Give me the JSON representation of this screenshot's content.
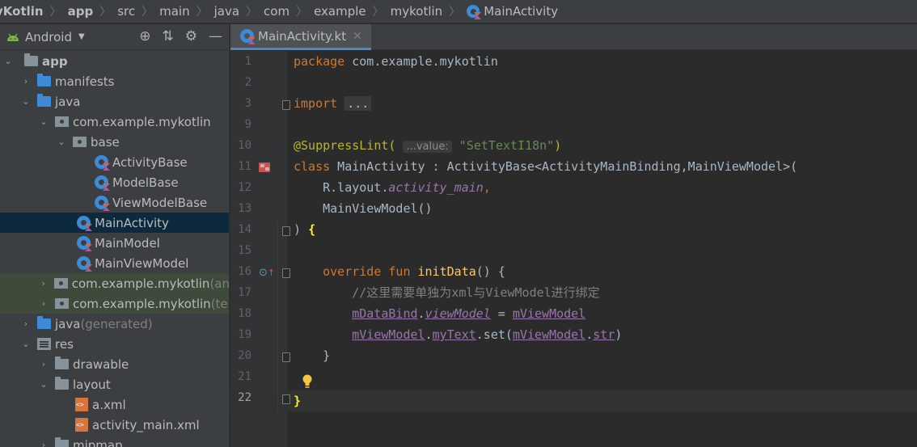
{
  "breadcrumb": [
    "yKotlin",
    "app",
    "src",
    "main",
    "java",
    "com",
    "example",
    "mykotlin",
    "MainActivity"
  ],
  "project": {
    "view_label": "Android",
    "toolbar_icons": [
      "locate-icon",
      "collapse-all-icon",
      "settings-gear-icon",
      "hide-icon"
    ],
    "tree": [
      {
        "label": "app",
        "suffix": "",
        "kind": "module",
        "expanded": true
      },
      {
        "label": "manifests",
        "suffix": "",
        "kind": "folder-blue",
        "expanded": false
      },
      {
        "label": "java",
        "suffix": "",
        "kind": "folder-blue",
        "expanded": true
      },
      {
        "label": "com.example.mykotlin",
        "suffix": "",
        "kind": "package",
        "expanded": true
      },
      {
        "label": "base",
        "suffix": "",
        "kind": "package",
        "expanded": true
      },
      {
        "label": "ActivityBase",
        "suffix": "",
        "kind": "kotlin"
      },
      {
        "label": "ModelBase",
        "suffix": "",
        "kind": "kotlin"
      },
      {
        "label": "ViewModelBase",
        "suffix": "",
        "kind": "kotlin"
      },
      {
        "label": "MainActivity",
        "suffix": "",
        "kind": "kotlin"
      },
      {
        "label": "MainModel",
        "suffix": "",
        "kind": "kotlin"
      },
      {
        "label": "MainViewModel",
        "suffix": "",
        "kind": "kotlin"
      },
      {
        "label": "com.example.mykotlin",
        "suffix": " (an",
        "kind": "package",
        "expanded": false
      },
      {
        "label": "com.example.mykotlin",
        "suffix": " (te",
        "kind": "package",
        "expanded": false
      },
      {
        "label": "java",
        "suffix": " (generated)",
        "kind": "folder-gen",
        "expanded": false
      },
      {
        "label": "res",
        "suffix": "",
        "kind": "res-folder",
        "expanded": true
      },
      {
        "label": "drawable",
        "suffix": "",
        "kind": "folder",
        "expanded": false
      },
      {
        "label": "layout",
        "suffix": "",
        "kind": "folder",
        "expanded": true
      },
      {
        "label": "a.xml",
        "suffix": "",
        "kind": "xml"
      },
      {
        "label": "activity_main.xml",
        "suffix": "",
        "kind": "xml"
      },
      {
        "label": "mipmap",
        "suffix": "",
        "kind": "folder",
        "expanded": false
      }
    ],
    "selected_item": "MainActivity"
  },
  "tabs": [
    {
      "label": "MainActivity.kt",
      "active": true,
      "close_icon": "close-icon"
    }
  ],
  "editor": {
    "line_numbers": [
      "1",
      "2",
      "3",
      "9",
      "10",
      "11",
      "12",
      "13",
      "14",
      "15",
      "16",
      "17",
      "18",
      "19",
      "20",
      "21",
      "22"
    ],
    "current_line": "22",
    "code": {
      "l1_kw": "package",
      "l1_rest": " com.example.mykotlin",
      "l3_kw": "import",
      "l3_dots": "...",
      "l10_ann": "@SuppressLint(",
      "l10_hint": "...value:",
      "l10_str": "\"SetTextI18n\"",
      "l10_close": ")",
      "l11_kw": "class",
      "l11_rest": " MainActivity : ActivityBase<ActivityMainBinding,MainViewModel>(",
      "l12_pre": "    R.layout.",
      "l12_prop": "activity_main",
      "l12_comma": ",",
      "l13": "    MainViewModel()",
      "l14_paren": ") ",
      "l14_brace": "{",
      "l16_kw": "    override fun ",
      "l16_fn": "initData",
      "l16_rest": "() {",
      "l17": "        //这里需要单独为xml与ViewModel进行绑定",
      "l18_a": "mDataBind",
      "l18_dot": ".",
      "l18_b": "viewModel",
      "l18_eq": " = ",
      "l18_c": "mViewModel",
      "l19_a": "mViewModel",
      "l19_dot": ".",
      "l19_b": "myText",
      "l19_set": ".set(",
      "l19_c": "mViewModel",
      "l19_dot2": ".",
      "l19_d": "str",
      "l19_close": ")",
      "l20": "    }",
      "l22": "}"
    },
    "gutter_icons": [
      "run-gutter-icon",
      "override-gutter-icon",
      "lightbulb-icon"
    ]
  },
  "colors": {
    "keyword": "#cc7832",
    "annotation": "#bbb529",
    "string": "#6a8759",
    "property": "#9876aa",
    "function": "#ffc66d",
    "comment": "#808080",
    "selection": "#0d293e"
  }
}
